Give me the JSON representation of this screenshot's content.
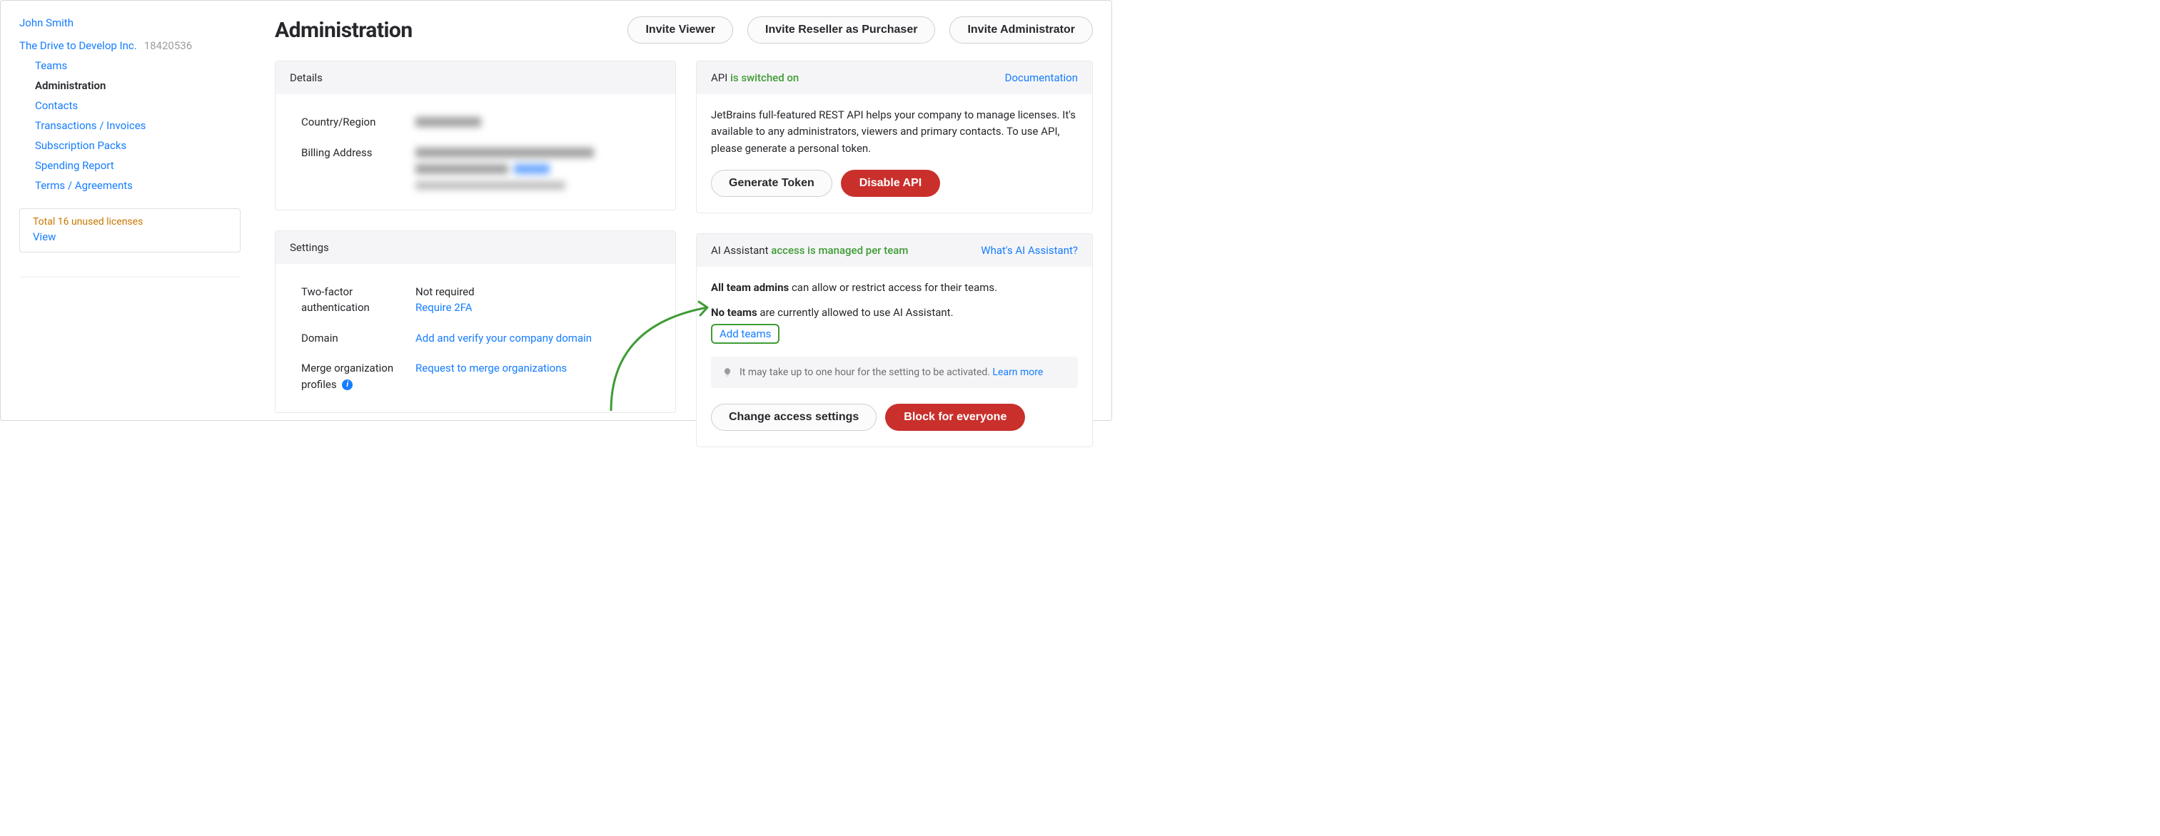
{
  "user": {
    "name": "John Smith"
  },
  "org": {
    "name": "The Drive to Develop Inc.",
    "id": "18420536"
  },
  "nav": {
    "teams": "Teams",
    "administration": "Administration",
    "contacts": "Contacts",
    "transactions": "Transactions / Invoices",
    "subscription_packs": "Subscription Packs",
    "spending_report": "Spending Report",
    "terms": "Terms / Agreements"
  },
  "licenses": {
    "line": "Total 16 unused licenses",
    "view": "View"
  },
  "header": {
    "title": "Administration",
    "invite_viewer": "Invite Viewer",
    "invite_reseller": "Invite Reseller as Purchaser",
    "invite_admin": "Invite Administrator"
  },
  "details": {
    "title": "Details",
    "country_label": "Country/Region",
    "billing_label": "Billing Address"
  },
  "settings": {
    "title": "Settings",
    "twofa_label": "Two-factor authentication",
    "twofa_status": "Not required",
    "twofa_action": "Require 2FA",
    "domain_label": "Domain",
    "domain_action": "Add and verify your company domain",
    "merge_label": "Merge organization profiles",
    "merge_action": "Request to merge organizations"
  },
  "api": {
    "title_prefix": "API ",
    "title_status": "is switched on",
    "doc": "Documentation",
    "text": "JetBrains full-featured REST API helps your company to manage licenses. It's available to any administrators, viewers and primary contacts. To use API, please generate a personal token.",
    "generate": "Generate Token",
    "disable": "Disable API"
  },
  "ai": {
    "title_prefix": "AI Assistant ",
    "title_status": "access is managed per team",
    "whats": "What's AI Assistant?",
    "line1_bold": "All team admins",
    "line1_rest": " can allow or restrict access for their teams.",
    "line2_bold": "No teams",
    "line2_rest": " are currently allowed to use AI Assistant.",
    "add_teams": "Add teams",
    "note": "It may take up to one hour for the setting to be activated. ",
    "learn_more": "Learn more",
    "change_access": "Change access settings",
    "block": "Block for everyone"
  }
}
